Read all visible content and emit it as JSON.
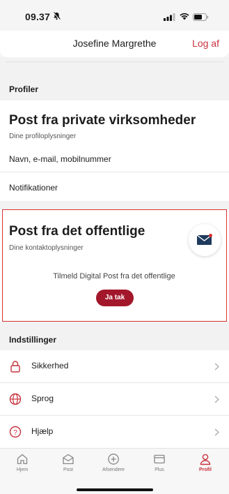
{
  "status_bar": {
    "time": "09.37"
  },
  "header": {
    "title": "Josefine Margrethe",
    "logout_label": "Log af"
  },
  "sections": {
    "profiles_heading": "Profiler",
    "settings_heading": "Indstillinger"
  },
  "private_card": {
    "title": "Post fra private virksomheder",
    "subtitle": "Dine profiloplysninger",
    "contact_line": "Navn, e-mail, mobilnummer",
    "notifications_label": "Notifikationer"
  },
  "public_card": {
    "title": "Post fra det offentlige",
    "subtitle": "Dine kontaktoplysninger",
    "signup_text": "Tilmeld Digital Post fra det offentlige",
    "button_label": "Ja tak"
  },
  "settings": [
    {
      "label": "Sikkerhed",
      "icon": "lock-icon"
    },
    {
      "label": "Sprog",
      "icon": "globe-icon"
    },
    {
      "label": "Hjælp",
      "icon": "help-icon"
    }
  ],
  "tabs": [
    {
      "label": "Hjem",
      "icon": "home-icon",
      "active": false
    },
    {
      "label": "Post",
      "icon": "mail-icon",
      "active": false
    },
    {
      "label": "Afsendere",
      "icon": "plus-circle-icon",
      "active": false
    },
    {
      "label": "Plus",
      "icon": "plus-window-icon",
      "active": false
    },
    {
      "label": "Profil",
      "icon": "profile-icon",
      "active": true
    }
  ],
  "colors": {
    "accent": "#c8323c",
    "button": "#a3172a",
    "highlight_border": "#d9302e"
  }
}
